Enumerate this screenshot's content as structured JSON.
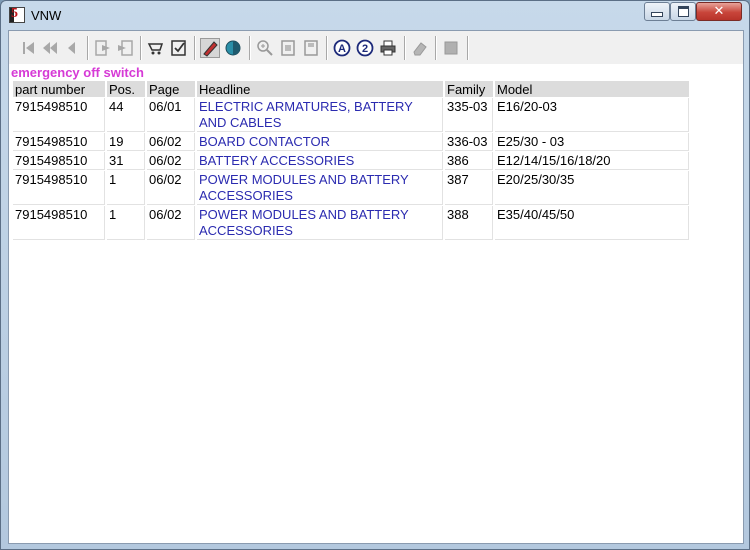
{
  "window": {
    "title": "VNW",
    "close_glyph": "✕"
  },
  "toolbar": {
    "buttons": [
      {
        "icon": "first-page-icon"
      },
      {
        "icon": "previous-page-icon"
      },
      {
        "icon": "back-icon"
      },
      {
        "icon": "export-icon"
      },
      {
        "icon": "import-icon"
      },
      {
        "icon": "cart-icon"
      },
      {
        "icon": "checklist-icon"
      },
      {
        "icon": "marker-icon"
      },
      {
        "icon": "globe-icon"
      },
      {
        "icon": "zoom-icon"
      },
      {
        "icon": "page-icon"
      },
      {
        "icon": "page-alt-icon"
      },
      {
        "icon": "letter-a-icon",
        "glyph": "A"
      },
      {
        "icon": "number-2-icon",
        "glyph": "2"
      },
      {
        "icon": "print-icon"
      },
      {
        "icon": "eraser-icon"
      },
      {
        "icon": "stop-icon"
      }
    ]
  },
  "content": {
    "heading": "emergency off switch",
    "columns": [
      "part number",
      "Pos.",
      "Page",
      "Headline",
      "Family",
      "Model"
    ],
    "rows": [
      {
        "part": "7915498510",
        "pos": "44",
        "page": "06/01",
        "headline_1": "ELECTRIC ARMATURES, BATTERY",
        "headline_2": "AND CABLES",
        "family": "335-03",
        "model": "E16/20-03"
      },
      {
        "part": "7915498510",
        "pos": "19",
        "page": "06/02",
        "headline_1": "BOARD CONTACTOR",
        "headline_2": "",
        "family": "336-03",
        "model": "E25/30 - 03"
      },
      {
        "part": "7915498510",
        "pos": "31",
        "page": "06/02",
        "headline_1": "BATTERY ACCESSORIES",
        "headline_2": "",
        "family": "386",
        "model": "E12/14/15/16/18/20"
      },
      {
        "part": "7915498510",
        "pos": "1",
        "page": "06/02",
        "headline_1": "POWER MODULES AND BATTERY",
        "headline_2": "ACCESSORIES",
        "family": "387",
        "model": "E20/25/30/35"
      },
      {
        "part": "7915498510",
        "pos": "1",
        "page": "06/02",
        "headline_1": "POWER MODULES AND BATTERY",
        "headline_2": "ACCESSORIES",
        "family": "388",
        "model": "E35/40/45/50"
      }
    ]
  },
  "colors": {
    "heading": "#d63ad6",
    "link": "#2b2bb0"
  }
}
